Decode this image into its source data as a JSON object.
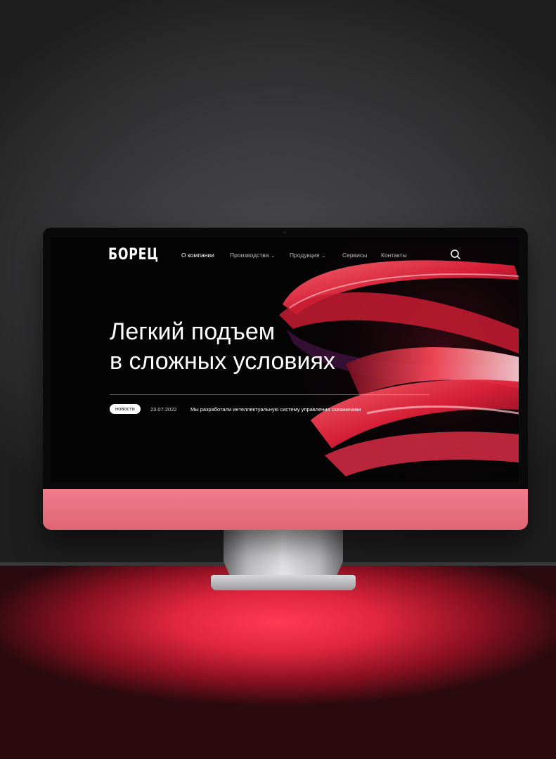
{
  "site": {
    "logo": "БОРЕЦ",
    "nav": [
      {
        "label": "О компании",
        "active": true,
        "has_dropdown": false
      },
      {
        "label": "Производства",
        "active": false,
        "has_dropdown": true
      },
      {
        "label": "Продукция",
        "active": false,
        "has_dropdown": true
      },
      {
        "label": "Сервисы",
        "active": false,
        "has_dropdown": false
      },
      {
        "label": "Контакты",
        "active": false,
        "has_dropdown": false
      }
    ],
    "search_icon": "search-icon",
    "hero": {
      "line1": "Легкий подъем",
      "line2": "в сложных условиях"
    },
    "news": {
      "tag": "новости",
      "date": "23.07.2022",
      "text": "Мы разработали интеллектуальную систему управления скважинами"
    }
  },
  "colors": {
    "accent": "#e8283f",
    "monitor_chin": "#ea7381",
    "screen_bg": "#050405"
  }
}
